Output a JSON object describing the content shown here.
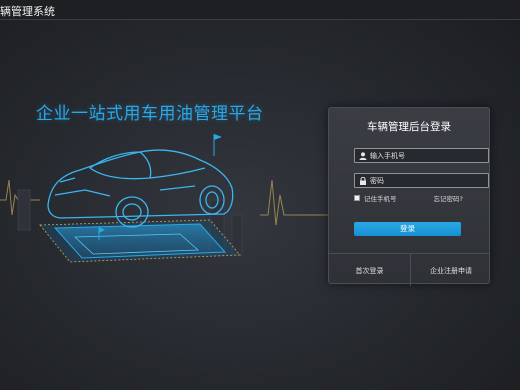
{
  "header": {
    "title": "辆管理系统"
  },
  "hero": {
    "slogan": "企业一站式用车用油管理平台"
  },
  "login": {
    "title": "车辆管理后台登录",
    "phone_placeholder": "输入手机号",
    "password_placeholder": "密码",
    "remember_label": "记住手机号",
    "forgot_label": "忘记密码?",
    "login_button": "登录",
    "first_login": "首次登录",
    "enterprise_register": "企业注册申请"
  },
  "colors": {
    "accent": "#2aa8e6",
    "background": "#25282d",
    "panel": "#33363c"
  },
  "icons": {
    "phone": "user-icon",
    "password": "lock-icon"
  }
}
